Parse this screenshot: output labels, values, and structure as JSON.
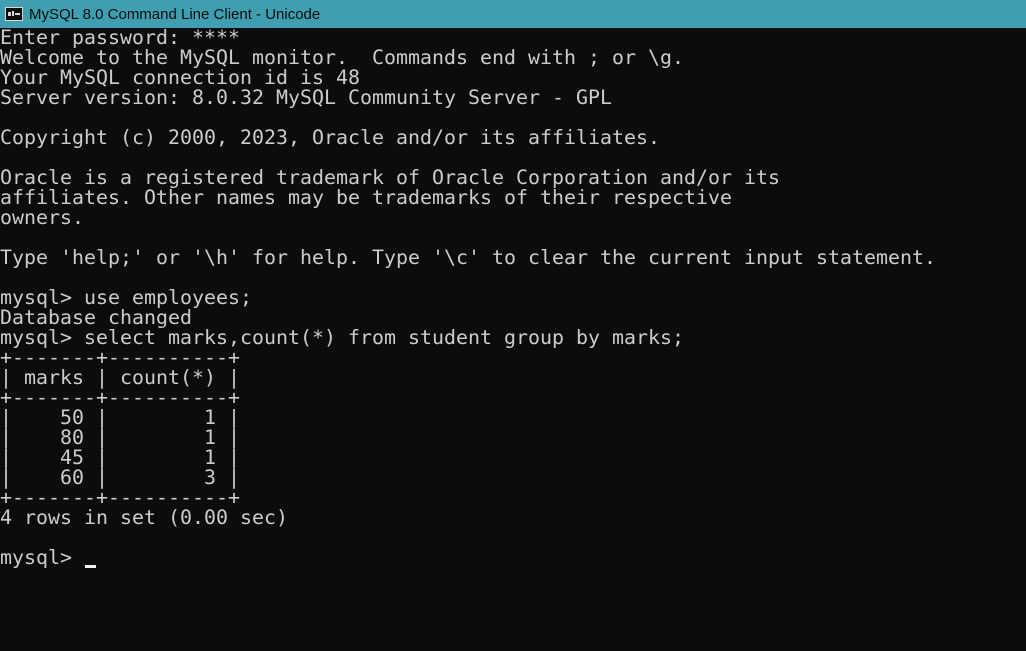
{
  "window": {
    "title": "MySQL 8.0 Command Line Client - Unicode",
    "icon": "mysql-console-icon"
  },
  "console": {
    "foreground": "#cccccc",
    "background": "#0c0c0c",
    "lines": [
      "Enter password: ****",
      "Welcome to the MySQL monitor.  Commands end with ; or \\g.",
      "Your MySQL connection id is 48",
      "Server version: 8.0.32 MySQL Community Server - GPL",
      "",
      "Copyright (c) 2000, 2023, Oracle and/or its affiliates.",
      "",
      "Oracle is a registered trademark of Oracle Corporation and/or its",
      "affiliates. Other names may be trademarks of their respective",
      "owners.",
      "",
      "Type 'help;' or '\\h' for help. Type '\\c' to clear the current input statement.",
      "",
      "mysql> use employees;",
      "Database changed",
      "mysql> select marks,count(*) from student group by marks;",
      "+-------+----------+",
      "| marks | count(*) |",
      "+-------+----------+",
      "|    50 |        1 |",
      "|    80 |        1 |",
      "|    45 |        1 |",
      "|    60 |        3 |",
      "+-------+----------+",
      "4 rows in set (0.00 sec)",
      "",
      "mysql> "
    ]
  }
}
